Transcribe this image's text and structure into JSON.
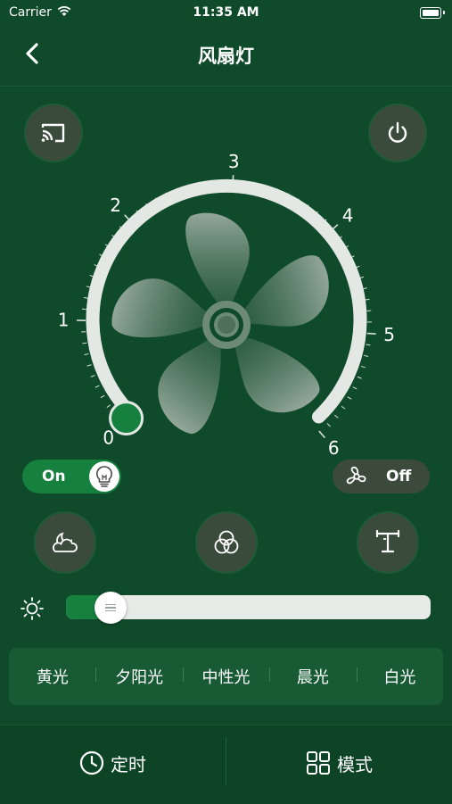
{
  "status_bar": {
    "carrier": "Carrier",
    "time": "11:35 AM"
  },
  "nav": {
    "title": "风扇灯"
  },
  "dial": {
    "ticks": [
      "0",
      "1",
      "2",
      "3",
      "4",
      "5",
      "6"
    ],
    "current_speed": 0,
    "min": 0,
    "max": 6
  },
  "light_toggle": {
    "label": "On",
    "state": true,
    "icon": "lightbulb-icon"
  },
  "fan_toggle": {
    "label": "Off",
    "state": false,
    "icon": "fan-icon"
  },
  "top_buttons": {
    "left_icon": "cast-icon",
    "right_icon": "power-icon"
  },
  "feature_buttons": [
    "moon-cloud-icon",
    "color-circles-icon",
    "ceiling-lamp-icon"
  ],
  "brightness": {
    "icon": "sun-icon",
    "level_fraction": 0.12
  },
  "light_modes": [
    "黄光",
    "夕阳光",
    "中性光",
    "晨光",
    "白光"
  ],
  "bottom_tabs": [
    {
      "label": "定时",
      "icon": "clock-icon"
    },
    {
      "label": "模式",
      "icon": "grid-icon"
    }
  ],
  "colors": {
    "background": "#0f4a2a",
    "accent": "#16803f",
    "button_bg": "#3a4a3b"
  }
}
